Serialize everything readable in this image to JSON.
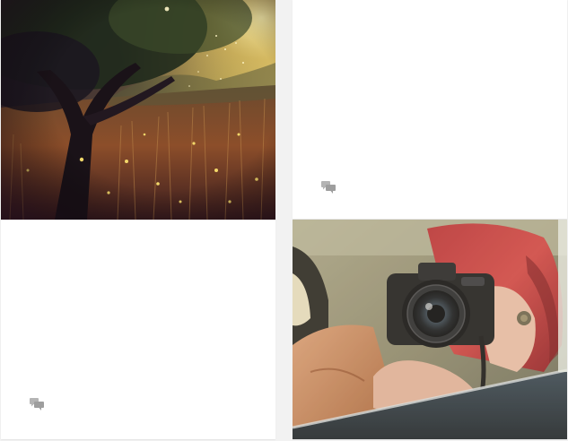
{
  "posts": [
    {
      "image": "forest-meadow-sunset-photo",
      "action_icon": "comment-icon"
    },
    {
      "image": "",
      "action_icon": "comment-icon"
    },
    {
      "image": "woman-with-camera-in-car-photo",
      "action_icon": ""
    }
  ],
  "colors": {
    "background": "#f2f2f2",
    "card": "#ffffff",
    "icon": "#b4b4b4"
  }
}
